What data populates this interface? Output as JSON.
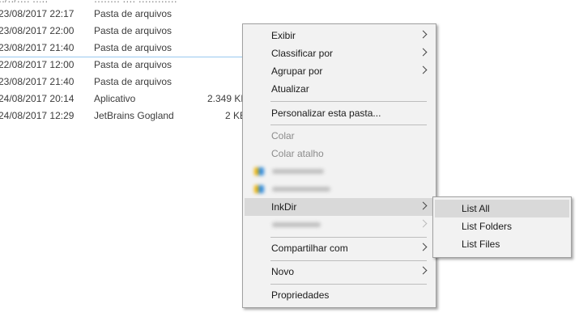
{
  "files": [
    {
      "date": "23/08/2017 22:17",
      "type": "Pasta de arquivos",
      "size": ""
    },
    {
      "date": "23/08/2017 22:00",
      "type": "Pasta de arquivos",
      "size": ""
    },
    {
      "date": "23/08/2017 21:40",
      "type": "Pasta de arquivos",
      "size": ""
    },
    {
      "date": "22/08/2017 12:00",
      "type": "Pasta de arquivos",
      "size": ""
    },
    {
      "date": "23/08/2017 21:40",
      "type": "Pasta de arquivos",
      "size": ""
    },
    {
      "date": "24/08/2017 20:14",
      "type": "Aplicativo",
      "size": "2.349 KB"
    },
    {
      "date": "24/08/2017 12:29",
      "type": "JetBrains Gogland",
      "size": "2 KB"
    }
  ],
  "context_menu": {
    "exibir": "Exibir",
    "classificar": "Classificar por",
    "agrupar": "Agrupar por",
    "atualizar": "Atualizar",
    "personalizar": "Personalizar esta pasta...",
    "colar": "Colar",
    "colar_atalho": "Colar atalho",
    "inkdir": "InkDir",
    "compartilhar": "Compartilhar com",
    "novo": "Novo",
    "propriedades": "Propriedades"
  },
  "submenu": {
    "list_all": "List All",
    "list_folders": "List Folders",
    "list_files": "List Files"
  },
  "colors": {
    "menu_bg": "#f2f2f2",
    "hover_bg": "#d9d9d9",
    "selection_line": "#99c9ef"
  }
}
